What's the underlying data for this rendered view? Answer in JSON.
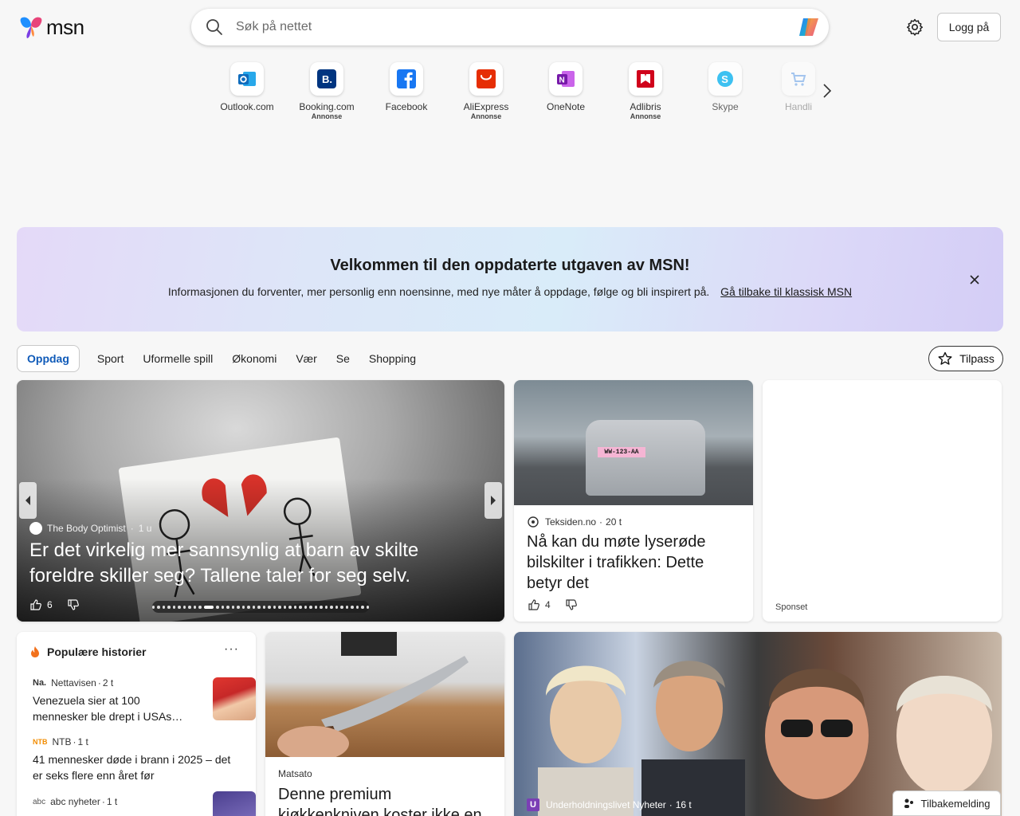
{
  "header": {
    "logo_text": "msn",
    "search_placeholder": "Søk på nettet",
    "login_label": "Logg på"
  },
  "quicklinks": [
    {
      "label": "Outlook.com",
      "ad": "",
      "icon": "outlook-icon",
      "color": "#0f6cbd"
    },
    {
      "label": "Booking.com",
      "ad": "Annonse",
      "icon": "booking-icon",
      "color": "#003580"
    },
    {
      "label": "Facebook",
      "ad": "",
      "icon": "facebook-icon",
      "color": "#1877f2"
    },
    {
      "label": "AliExpress",
      "ad": "Annonse",
      "icon": "aliexpress-icon",
      "color": "#e62e04"
    },
    {
      "label": "OneNote",
      "ad": "",
      "icon": "onenote-icon",
      "color": "#7719aa"
    },
    {
      "label": "Adlibris",
      "ad": "Annonse",
      "icon": "adlibris-icon",
      "color": "#d0021b"
    },
    {
      "label": "Skype",
      "ad": "",
      "icon": "skype-icon",
      "color": "#00aff0"
    },
    {
      "label": "Handli",
      "ad": "",
      "icon": "shopping-cart-icon",
      "color": "#2a7de1"
    }
  ],
  "banner": {
    "title": "Velkommen til den oppdaterte utgaven av MSN!",
    "description": "Informasjonen du forventer, mer personlig enn noensinne, med nye måter å oppdage, følge og bli inspirert på.",
    "link": "Gå tilbake til klassisk MSN"
  },
  "tabs": [
    "Oppdag",
    "Sport",
    "Uformelle spill",
    "Økonomi",
    "Vær",
    "Se",
    "Shopping"
  ],
  "customize_label": "Tilpass",
  "hero": {
    "source": "The Body Optimist",
    "time": "1 u",
    "title": "Er det virkelig mer sannsynlig at barn av skilte foreldre skiller seg? Tallene taler for seg selv.",
    "likes": "6"
  },
  "car_card": {
    "source": "Teksiden.no",
    "time": "20 t",
    "title": "Nå kan du møte lyserøde bilskilter i trafikken: Dette betyr det",
    "likes": "4",
    "plate": "WW-123-AA"
  },
  "ad_card": {
    "label": "Sponset"
  },
  "popular": {
    "heading": "Populære historier",
    "more": "···",
    "items": [
      {
        "badge": "Na.",
        "source": "Nettavisen",
        "time": "2 t",
        "title": "Venezuela sier at 100 mennesker ble drept i USAs…"
      },
      {
        "badge": "NTB",
        "source": "NTB",
        "time": "1 t",
        "title": "41 mennesker døde i brann i 2025 – det er seks flere enn året før"
      },
      {
        "badge": "abc",
        "source": "abc nyheter",
        "time": "1 t",
        "title": ""
      }
    ]
  },
  "knife_card": {
    "source": "Matsato",
    "title": "Denne premium kjøkkenkniven koster ikke en"
  },
  "abba_card": {
    "badge": "U",
    "source": "Underholdningslivet Nyheter",
    "time": "16 t"
  },
  "feedback_label": "Tilbakemelding"
}
